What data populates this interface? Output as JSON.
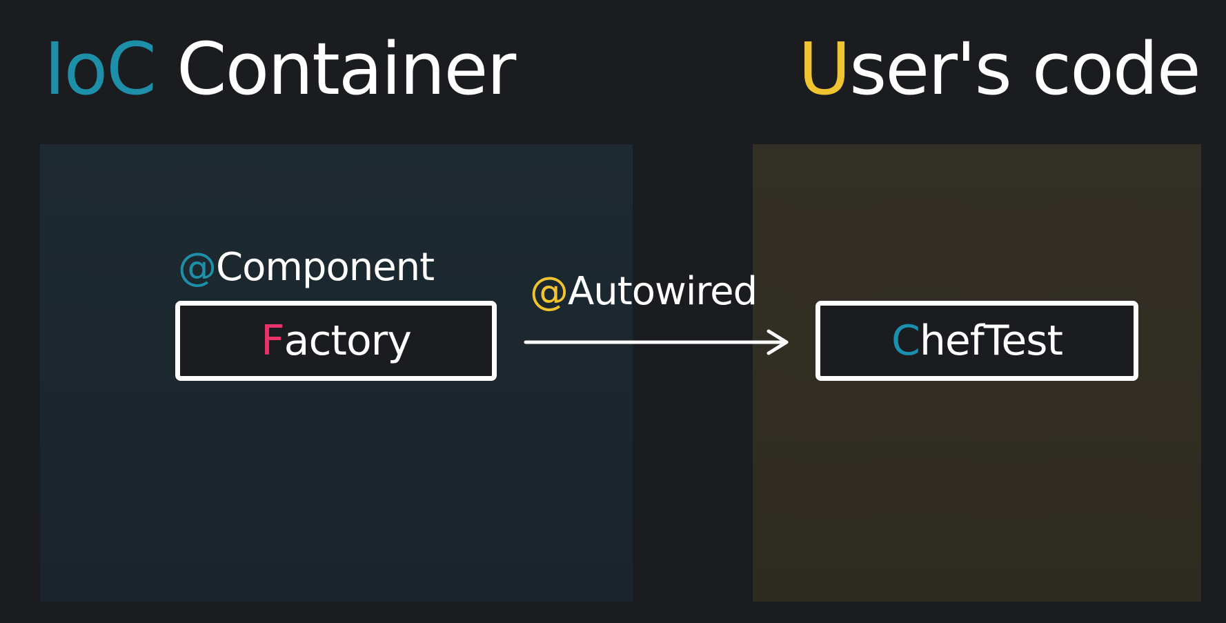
{
  "titles": {
    "left": {
      "accent": "IoC",
      "rest": " Container"
    },
    "right": {
      "accent": "U",
      "rest": "ser's code"
    }
  },
  "annotations": {
    "component": {
      "accent": "@",
      "rest": "Component"
    },
    "autowired": {
      "accent": "@",
      "rest": "Autowired"
    }
  },
  "nodes": {
    "factory": {
      "accent": "F",
      "rest": "actory"
    },
    "chef_test": {
      "accent": "C",
      "rest": "hefTest"
    }
  },
  "colors": {
    "background": "#1b1c1f",
    "ioc_teal": "#1e8fa8",
    "user_yellow": "#f0c330",
    "factory_pink": "#e8336c",
    "chef_cyan": "#1a8fae",
    "ioc_panel": "#1e2a31",
    "user_panel": "#322f27"
  },
  "edge": {
    "from": "factory",
    "to": "chef_test",
    "style": "arrow"
  }
}
